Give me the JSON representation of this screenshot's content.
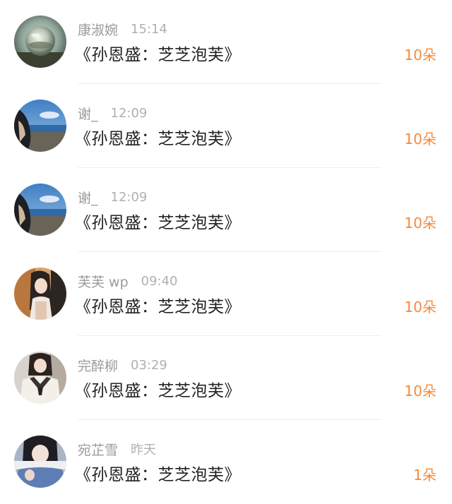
{
  "gifts": [
    {
      "name": "康淑婉",
      "time": "15:14",
      "gift": "《孙恩盛：芝芝泡芙》",
      "amount": "10朵",
      "avatar": "crystal-ball-avatar"
    },
    {
      "name": "谢_",
      "time": "12:09",
      "gift": "《孙恩盛：芝芝泡芙》",
      "amount": "10朵",
      "avatar": "beach-girl-avatar"
    },
    {
      "name": "谢_",
      "time": "12:09",
      "gift": "《孙恩盛：芝芝泡芙》",
      "amount": "10朵",
      "avatar": "beach-girl-avatar"
    },
    {
      "name": "芙芙 wp",
      "time": "09:40",
      "gift": "《孙恩盛：芝芝泡芙》",
      "amount": "10朵",
      "avatar": "girl-car-avatar"
    },
    {
      "name": "完醉柳",
      "time": "03:29",
      "gift": "《孙恩盛：芝芝泡芙》",
      "amount": "10朵",
      "avatar": "uniform-girl-avatar"
    },
    {
      "name": "宛芷雪",
      "time": "昨天",
      "gift": "《孙恩盛：芝芝泡芙》",
      "amount": "1朵",
      "avatar": "denim-girl-avatar"
    }
  ],
  "colors": {
    "amount": "#f58a3c",
    "name": "#9a9a9a",
    "time": "#b0b0b0",
    "gift_text": "#222222"
  }
}
